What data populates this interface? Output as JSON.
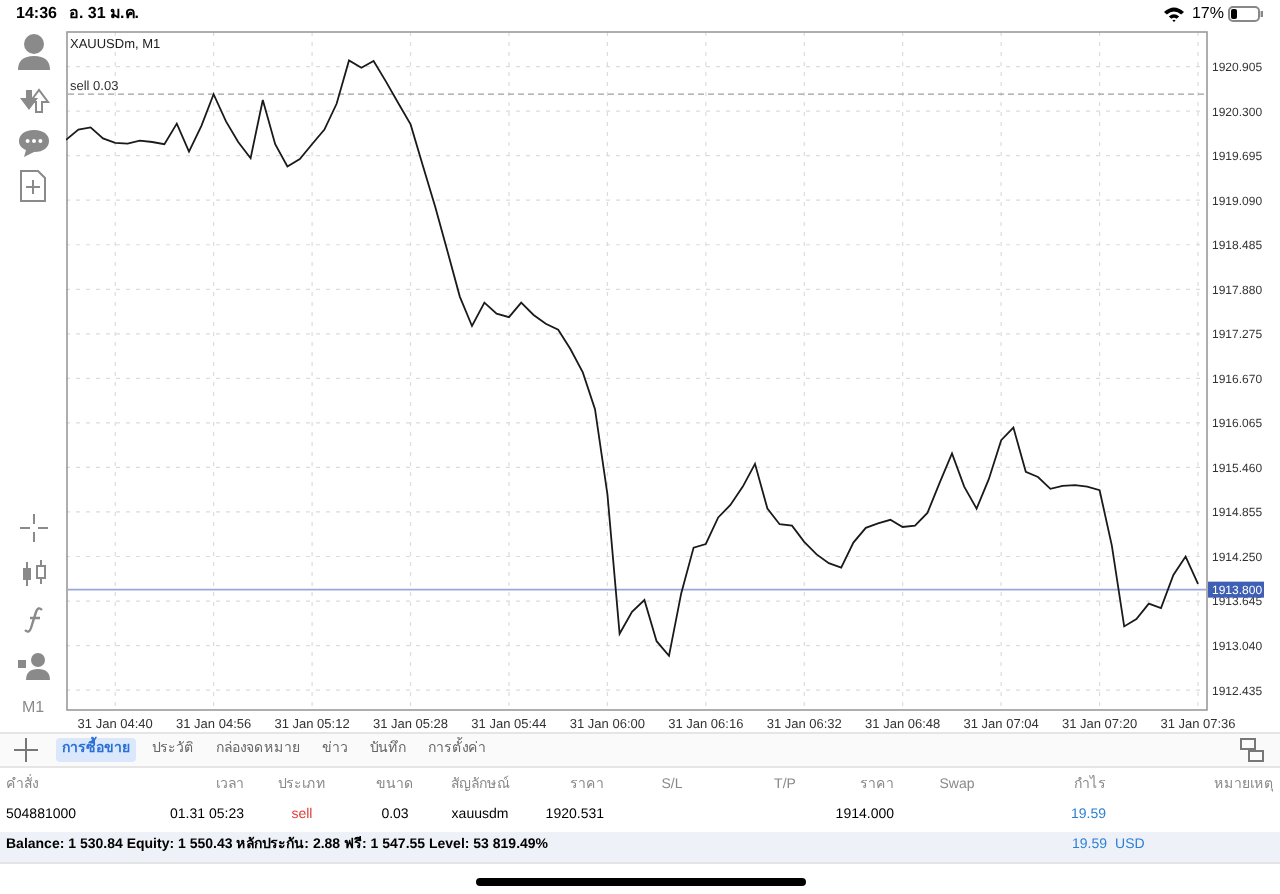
{
  "status_bar": {
    "time": "14:36",
    "date": "อ. 31 ม.ค.",
    "battery": "17%"
  },
  "toolbar": {
    "timeframe": "M1"
  },
  "chart": {
    "chart_data": {
      "type": "line",
      "title": "XAUUSDm, M1",
      "categories": [
        null,
        null,
        null,
        null,
        "31 Jan 04:40",
        null,
        null,
        null,
        null,
        null,
        null,
        null,
        "31 Jan 04:56",
        null,
        null,
        null,
        null,
        null,
        null,
        null,
        "31 Jan 05:12",
        null,
        null,
        null,
        null,
        null,
        null,
        null,
        "31 Jan 05:28",
        null,
        null,
        null,
        null,
        null,
        null,
        null,
        "31 Jan 05:44",
        null,
        null,
        null,
        null,
        null,
        null,
        null,
        "31 Jan 06:00",
        null,
        null,
        null,
        null,
        null,
        null,
        null,
        "31 Jan 06:16",
        null,
        null,
        null,
        null,
        null,
        null,
        null,
        "31 Jan 06:32",
        null,
        null,
        null,
        null,
        null,
        null,
        null,
        "31 Jan 06:48",
        null,
        null,
        null,
        null,
        null,
        null,
        null,
        "31 Jan 07:04",
        null,
        null,
        null,
        null,
        null,
        null,
        null,
        "31 Jan 07:20",
        null,
        null,
        null,
        null,
        null,
        null,
        null,
        "31 Jan 07:36"
      ],
      "series": [
        {
          "color": "#1a1a1a",
          "values": [
            1919.91,
            1920.05,
            1920.08,
            1919.93,
            1919.87,
            1919.86,
            1919.9,
            1919.88,
            1919.85,
            1920.13,
            1919.75,
            1920.1,
            1920.53,
            1920.16,
            1919.88,
            1919.66,
            1920.45,
            1919.85,
            1919.55,
            1919.65,
            1919.85,
            1920.05,
            1920.4,
            1920.99,
            1920.89,
            1920.98,
            1920.7,
            1920.41,
            1920.12,
            1919.56,
            1919.0,
            1918.4,
            1917.78,
            1917.38,
            1917.7,
            1917.55,
            1917.5,
            1917.7,
            1917.53,
            1917.41,
            1917.33,
            1917.07,
            1916.75,
            1916.25,
            1915.1,
            1913.2,
            1913.5,
            1913.66,
            1913.1,
            1912.9,
            1913.75,
            1914.37,
            1914.42,
            1914.78,
            1914.95,
            1915.2,
            1915.51,
            1914.9,
            1914.69,
            1914.67,
            1914.45,
            1914.28,
            1914.16,
            1914.1,
            1914.44,
            1914.64,
            1914.7,
            1914.75,
            1914.65,
            1914.67,
            1914.84,
            1915.25,
            1915.65,
            1915.2,
            1914.9,
            1915.3,
            1915.83,
            1916.0,
            1915.4,
            1915.33,
            1915.17,
            1915.21,
            1915.22,
            1915.2,
            1915.15,
            1914.4,
            1913.3,
            1913.4,
            1913.61,
            1913.55,
            1914.0,
            1914.25,
            1913.88
          ]
        }
      ],
      "ylim": [
        1912.165,
        1921.375
      ],
      "yticks": [
        {
          "value": 1920.905,
          "label": "1920.905"
        },
        {
          "value": 1920.3,
          "label": "1920.300"
        },
        {
          "value": 1919.695,
          "label": "1919.695"
        },
        {
          "value": 1919.09,
          "label": "1919.090"
        },
        {
          "value": 1918.485,
          "label": "1918.485"
        },
        {
          "value": 1917.88,
          "label": "1917.880"
        },
        {
          "value": 1917.275,
          "label": "1917.275"
        },
        {
          "value": 1916.67,
          "label": "1916.670"
        },
        {
          "value": 1916.065,
          "label": "1916.065"
        },
        {
          "value": 1915.46,
          "label": "1915.460"
        },
        {
          "value": 1914.855,
          "label": "1914.855"
        },
        {
          "value": 1914.25,
          "label": "1914.250"
        },
        {
          "value": 1913.645,
          "label": "1913.645"
        },
        {
          "value": 1913.04,
          "label": "1913.040"
        },
        {
          "value": 1912.435,
          "label": "1912.435"
        }
      ],
      "grid": true,
      "ref_lines": [
        {
          "axis": "y",
          "value": 1920.531,
          "label": "sell 0.03"
        },
        {
          "axis": "y",
          "value": 1913.8,
          "label": "1913.800"
        }
      ]
    }
  },
  "tabs": [
    {
      "label": "การซื้อขาย",
      "selected": true
    },
    {
      "label": "ประวัติ",
      "selected": false
    },
    {
      "label": "กล่องจดหมาย",
      "selected": false
    },
    {
      "label": "ข่าว",
      "selected": false
    },
    {
      "label": "บันทึก",
      "selected": false
    },
    {
      "label": "การตั้งค่า",
      "selected": false
    }
  ],
  "table": {
    "columns": [
      "คำสั่ง",
      "เวลา",
      "ประเภท",
      "ขนาด",
      "สัญลักษณ์",
      "ราคา",
      "S/L",
      "T/P",
      "ราคา",
      "Swap",
      "กำไร",
      "หมายเหตุ"
    ],
    "rows": [
      {
        "kind": "sell",
        "cells": [
          "504881000",
          "01.31 05:23",
          "sell",
          "0.03",
          "xauusdm",
          "1920.531",
          "",
          "",
          "1914.000",
          "",
          "19.59",
          ""
        ]
      }
    ]
  },
  "summary": {
    "text": "Balance: 1 530.84 Equity: 1 550.43 หลักประกัน: 2.88 ฟรี: 1 547.55 Level: 53 819.49%",
    "profit": "19.59",
    "currency": "USD"
  }
}
